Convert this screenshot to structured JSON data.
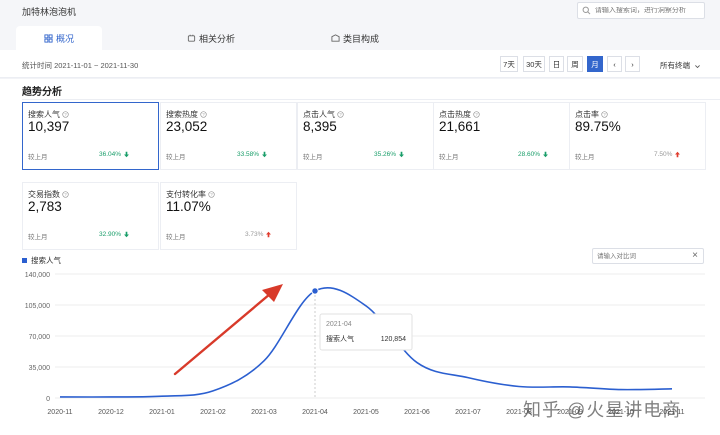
{
  "app": {
    "title": "加特林泡泡机",
    "search_placeholder": "请输入搜索词，进行洞察分析"
  },
  "tabs": [
    {
      "label": "概况",
      "icon": "grid-icon",
      "active": true
    },
    {
      "label": "相关分析",
      "icon": "link-icon",
      "active": false
    },
    {
      "label": "类目构成",
      "icon": "category-icon",
      "active": false
    }
  ],
  "toolbar": {
    "stat_time": "统计时间 2021-11-01 ~ 2021-11-30",
    "periods": [
      "7天",
      "30天",
      "日",
      "周",
      "月"
    ],
    "active_period": "月",
    "prev": "‹",
    "next": "›",
    "terminal": "所有终端"
  },
  "section": {
    "title": "趋势分析"
  },
  "metrics": [
    {
      "label": "搜索人气",
      "value": "10,397",
      "compare": "较上月",
      "pct": "36.04%",
      "trend": "down"
    },
    {
      "label": "搜索热度",
      "value": "23,052",
      "compare": "较上月",
      "pct": "33.58%",
      "trend": "down"
    },
    {
      "label": "点击人气",
      "value": "8,395",
      "compare": "较上月",
      "pct": "35.26%",
      "trend": "down"
    },
    {
      "label": "点击热度",
      "value": "21,661",
      "compare": "较上月",
      "pct": "28.60%",
      "trend": "down"
    },
    {
      "label": "点击率",
      "value": "89.75%",
      "compare": "较上月",
      "pct": "7.50%",
      "trend": "up"
    },
    {
      "label": "交易指数",
      "value": "2,783",
      "compare": "较上月",
      "pct": "32.90%",
      "trend": "down"
    },
    {
      "label": "支付转化率",
      "value": "11.07%",
      "compare": "较上月",
      "pct": "3.73%",
      "trend": "up"
    }
  ],
  "colors": {
    "accent": "#3366cc",
    "line": "#2b5fd0",
    "down": "#1a9e6a",
    "up": "#e03c2e",
    "annotation": "#d83a2a"
  },
  "compare": {
    "placeholder": "请输入对比词"
  },
  "tooltip": {
    "date": "2021-04",
    "label": "搜索人气",
    "value": "120,854"
  },
  "watermark": "知乎 @火星讲电商",
  "chart_data": {
    "type": "line",
    "x": [
      "2020-11",
      "2020-12",
      "2021-01",
      "2021-02",
      "2021-03",
      "2021-04",
      "2021-05",
      "2021-06",
      "2021-07",
      "2021-08",
      "2021-09",
      "2021-10",
      "2021-11"
    ],
    "series": [
      {
        "name": "搜索人气",
        "values": [
          1200,
          1200,
          2000,
          8000,
          42000,
          120854,
          104000,
          40000,
          23000,
          13000,
          12500,
          9500,
          10397
        ]
      }
    ],
    "yticks": [
      "0",
      "35,000",
      "70,000",
      "105,000",
      "140,000"
    ],
    "ylim": [
      0,
      140000
    ],
    "grid": true,
    "legend": "top-left"
  }
}
